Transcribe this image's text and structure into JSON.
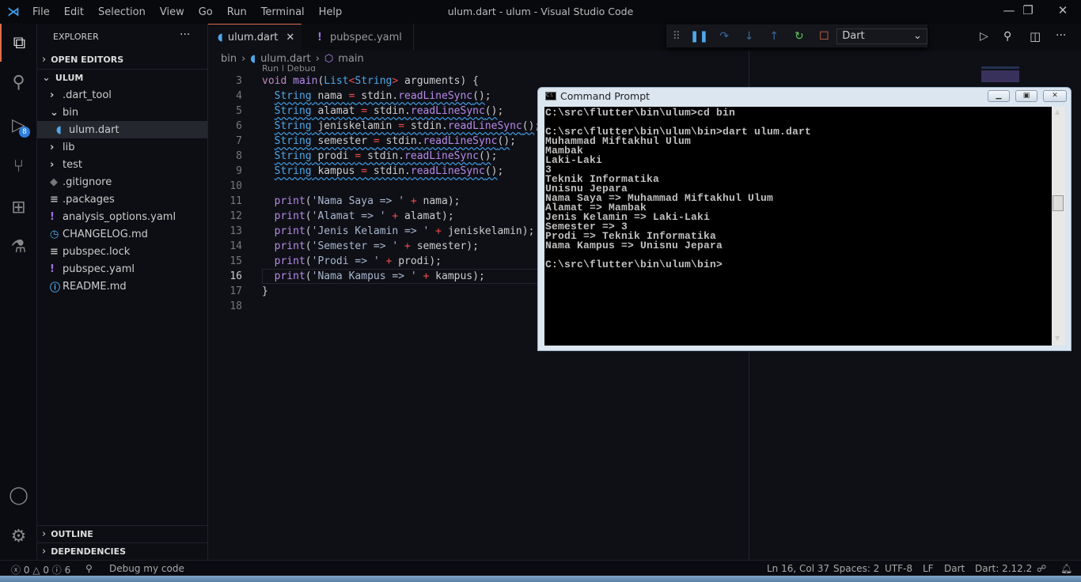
{
  "window": {
    "title": "ulum.dart - ulum - Visual Studio Code",
    "menu": [
      "File",
      "Edit",
      "Selection",
      "View",
      "Go",
      "Run",
      "Terminal",
      "Help"
    ]
  },
  "activity": {
    "debug_badge": "8"
  },
  "sidebar": {
    "title": "EXPLORER",
    "more": "···",
    "open_editors": "OPEN EDITORS",
    "folder": "ULUM",
    "items": [
      {
        "label": ".dart_tool",
        "icon": "chevron-right-icon",
        "depth": 1
      },
      {
        "label": "bin",
        "icon": "chevron-down-icon",
        "depth": 1
      },
      {
        "label": "ulum.dart",
        "icon": "dart-icon",
        "depth": 2,
        "selected": true
      },
      {
        "label": "lib",
        "icon": "chevron-right-icon",
        "depth": 1
      },
      {
        "label": "test",
        "icon": "chevron-right-icon",
        "depth": 1
      },
      {
        "label": ".gitignore",
        "icon": "git-icon",
        "depth": 1
      },
      {
        "label": ".packages",
        "icon": "lines-icon",
        "depth": 1
      },
      {
        "label": "analysis_options.yaml",
        "icon": "yaml-icon",
        "depth": 1
      },
      {
        "label": "CHANGELOG.md",
        "icon": "clock-icon",
        "depth": 1
      },
      {
        "label": "pubspec.lock",
        "icon": "lines-icon",
        "depth": 1
      },
      {
        "label": "pubspec.yaml",
        "icon": "yaml-icon",
        "depth": 1
      },
      {
        "label": "README.md",
        "icon": "info-icon",
        "depth": 1
      }
    ],
    "outline": "OUTLINE",
    "dependencies": "DEPENDENCIES"
  },
  "tabs": [
    {
      "label": "ulum.dart",
      "active": true
    },
    {
      "label": "pubspec.yaml"
    }
  ],
  "breadcrumb": [
    "bin",
    "ulum.dart",
    "main"
  ],
  "codelens": "Run | Debug",
  "debug_toolbar": {
    "config": "Dart"
  },
  "code": [
    {
      "n": "3",
      "t": [
        [
          "kw",
          "void "
        ],
        [
          "fn",
          "main"
        ],
        [
          "id",
          "("
        ],
        [
          "ty",
          "List"
        ],
        [
          "op",
          "<"
        ],
        [
          "ty",
          "String"
        ],
        [
          "op",
          "> "
        ],
        [
          "id",
          "arguments) {"
        ]
      ]
    },
    {
      "n": "4",
      "t": [
        [
          "id",
          "  "
        ],
        [
          "ty sq",
          "String"
        ],
        [
          "id sq",
          " nama "
        ],
        [
          "op sq",
          "="
        ],
        [
          "id sq",
          " stdin."
        ],
        [
          "fn sq",
          "readLineSync"
        ],
        [
          "id sq",
          "()"
        ],
        [
          "id",
          ";"
        ]
      ]
    },
    {
      "n": "5",
      "t": [
        [
          "id",
          "  "
        ],
        [
          "ty sq",
          "String"
        ],
        [
          "id sq",
          " alamat "
        ],
        [
          "op sq",
          "="
        ],
        [
          "id sq",
          " stdin."
        ],
        [
          "fn sq",
          "readLineSync"
        ],
        [
          "id sq",
          "()"
        ],
        [
          "id",
          ";"
        ]
      ]
    },
    {
      "n": "6",
      "t": [
        [
          "id",
          "  "
        ],
        [
          "ty sq",
          "String"
        ],
        [
          "id sq",
          " jeniskelamin "
        ],
        [
          "op sq",
          "="
        ],
        [
          "id sq",
          " stdin."
        ],
        [
          "fn sq",
          "readLineSync"
        ],
        [
          "id sq",
          "()"
        ],
        [
          "id",
          ";"
        ]
      ]
    },
    {
      "n": "7",
      "t": [
        [
          "id",
          "  "
        ],
        [
          "ty sq",
          "String"
        ],
        [
          "id sq",
          " semester "
        ],
        [
          "op sq",
          "="
        ],
        [
          "id sq",
          " stdin."
        ],
        [
          "fn sq",
          "readLineSync"
        ],
        [
          "id sq",
          "()"
        ],
        [
          "id",
          ";"
        ]
      ]
    },
    {
      "n": "8",
      "t": [
        [
          "id",
          "  "
        ],
        [
          "ty sq",
          "String"
        ],
        [
          "id sq",
          " prodi "
        ],
        [
          "op sq",
          "="
        ],
        [
          "id sq",
          " stdin."
        ],
        [
          "fn sq",
          "readLineSync"
        ],
        [
          "id sq",
          "()"
        ],
        [
          "id",
          ";"
        ]
      ]
    },
    {
      "n": "9",
      "t": [
        [
          "id",
          "  "
        ],
        [
          "ty sq",
          "String"
        ],
        [
          "id sq",
          " kampus "
        ],
        [
          "op sq",
          "="
        ],
        [
          "id sq",
          " stdin."
        ],
        [
          "fn sq",
          "readLineSync"
        ],
        [
          "id sq",
          "()"
        ],
        [
          "id",
          ";"
        ]
      ]
    },
    {
      "n": "10",
      "t": []
    },
    {
      "n": "11",
      "t": [
        [
          "id",
          "  "
        ],
        [
          "fn",
          "print"
        ],
        [
          "id",
          "("
        ],
        [
          "st",
          "'Nama Saya => '"
        ],
        [
          "op",
          " + "
        ],
        [
          "id",
          "nama);"
        ]
      ]
    },
    {
      "n": "12",
      "t": [
        [
          "id",
          "  "
        ],
        [
          "fn",
          "print"
        ],
        [
          "id",
          "("
        ],
        [
          "st",
          "'Alamat => '"
        ],
        [
          "op",
          " + "
        ],
        [
          "id",
          "alamat);"
        ]
      ]
    },
    {
      "n": "13",
      "t": [
        [
          "id",
          "  "
        ],
        [
          "fn",
          "print"
        ],
        [
          "id",
          "("
        ],
        [
          "st",
          "'Jenis Kelamin => '"
        ],
        [
          "op",
          " + "
        ],
        [
          "id",
          "jeniskelamin);"
        ]
      ]
    },
    {
      "n": "14",
      "t": [
        [
          "id",
          "  "
        ],
        [
          "fn",
          "print"
        ],
        [
          "id",
          "("
        ],
        [
          "st",
          "'Semester => '"
        ],
        [
          "op",
          " + "
        ],
        [
          "id",
          "semester);"
        ]
      ]
    },
    {
      "n": "15",
      "t": [
        [
          "id",
          "  "
        ],
        [
          "fn",
          "print"
        ],
        [
          "id",
          "("
        ],
        [
          "st",
          "'Prodi => '"
        ],
        [
          "op",
          " + "
        ],
        [
          "id",
          "prodi);"
        ]
      ]
    },
    {
      "n": "16",
      "t": [
        [
          "id",
          "  "
        ],
        [
          "fn",
          "print"
        ],
        [
          "id",
          "("
        ],
        [
          "st",
          "'Nama Kampus => '"
        ],
        [
          "op",
          " + "
        ],
        [
          "id",
          "kampus);"
        ]
      ]
    },
    {
      "n": "17",
      "t": [
        [
          "id",
          "}"
        ]
      ]
    },
    {
      "n": "18",
      "t": []
    }
  ],
  "cmd": {
    "title": "Command Prompt",
    "output": "C:\\src\\flutter\\bin\\ulum>cd bin\n\nC:\\src\\flutter\\bin\\ulum\\bin>dart ulum.dart\nMuhammad Miftakhul Ulum\nMambak\nLaki-Laki\n3\nTeknik Informatika\nUnisnu Jepara\nNama Saya => Muhammad Miftakhul Ulum\nAlamat => Mambak\nJenis Kelamin => Laki-Laki\nSemester => 3\nProdi => Teknik Informatika\nNama Kampus => Unisnu Jepara\n\nC:\\src\\flutter\\bin\\ulum\\bin>"
  },
  "status": {
    "errors": "0",
    "warnings": "0",
    "infos": "6",
    "debug": "Debug my code",
    "position": "Ln 16, Col 37",
    "spaces": "Spaces: 2",
    "encoding": "UTF-8",
    "eol": "LF",
    "language": "Dart",
    "sdk": "Dart: 2.12.2"
  }
}
